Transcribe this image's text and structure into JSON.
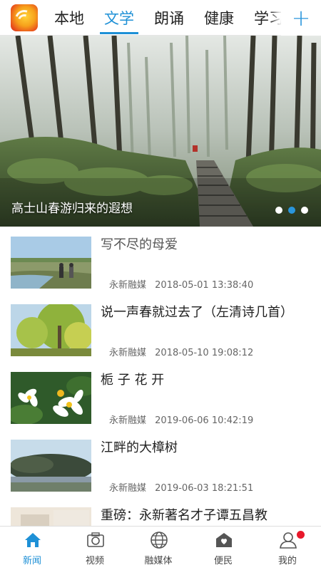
{
  "tabs": [
    {
      "label": "本地"
    },
    {
      "label": "文学"
    },
    {
      "label": "朗诵"
    },
    {
      "label": "健康"
    },
    {
      "label": "学习"
    }
  ],
  "active_tab": "文学",
  "add_button": "+",
  "hero": {
    "caption": "高士山春游归来的遐想",
    "dot_count": 3,
    "active_dot": 2
  },
  "news": [
    {
      "title": "写不尽的母爱",
      "source": "永新融媒",
      "time": "2018-05-01 13:38:40"
    },
    {
      "title": "说一声春就过去了（左清诗几首）",
      "source": "永新融媒",
      "time": "2018-05-10 19:08:12"
    },
    {
      "title": "栀 子 花 开",
      "source": "永新融媒",
      "time": "2019-06-06 10:42:19"
    },
    {
      "title": "江畔的大樟树",
      "source": "永新融媒",
      "time": "2019-06-03 18:21:51"
    },
    {
      "title": "重磅：永新著名才子谭五昌教",
      "source": "",
      "time": ""
    }
  ],
  "bottom_nav": [
    {
      "label": "新闻",
      "icon": "home-icon",
      "active": true
    },
    {
      "label": "视频",
      "icon": "camera-icon",
      "active": false
    },
    {
      "label": "融媒体",
      "icon": "globe-icon",
      "active": false
    },
    {
      "label": "便民",
      "icon": "service-icon",
      "active": false
    },
    {
      "label": "我的",
      "icon": "user-icon",
      "active": false,
      "badge": true
    }
  ],
  "colors": {
    "accent": "#1e90d6",
    "badge": "#e8182b"
  }
}
